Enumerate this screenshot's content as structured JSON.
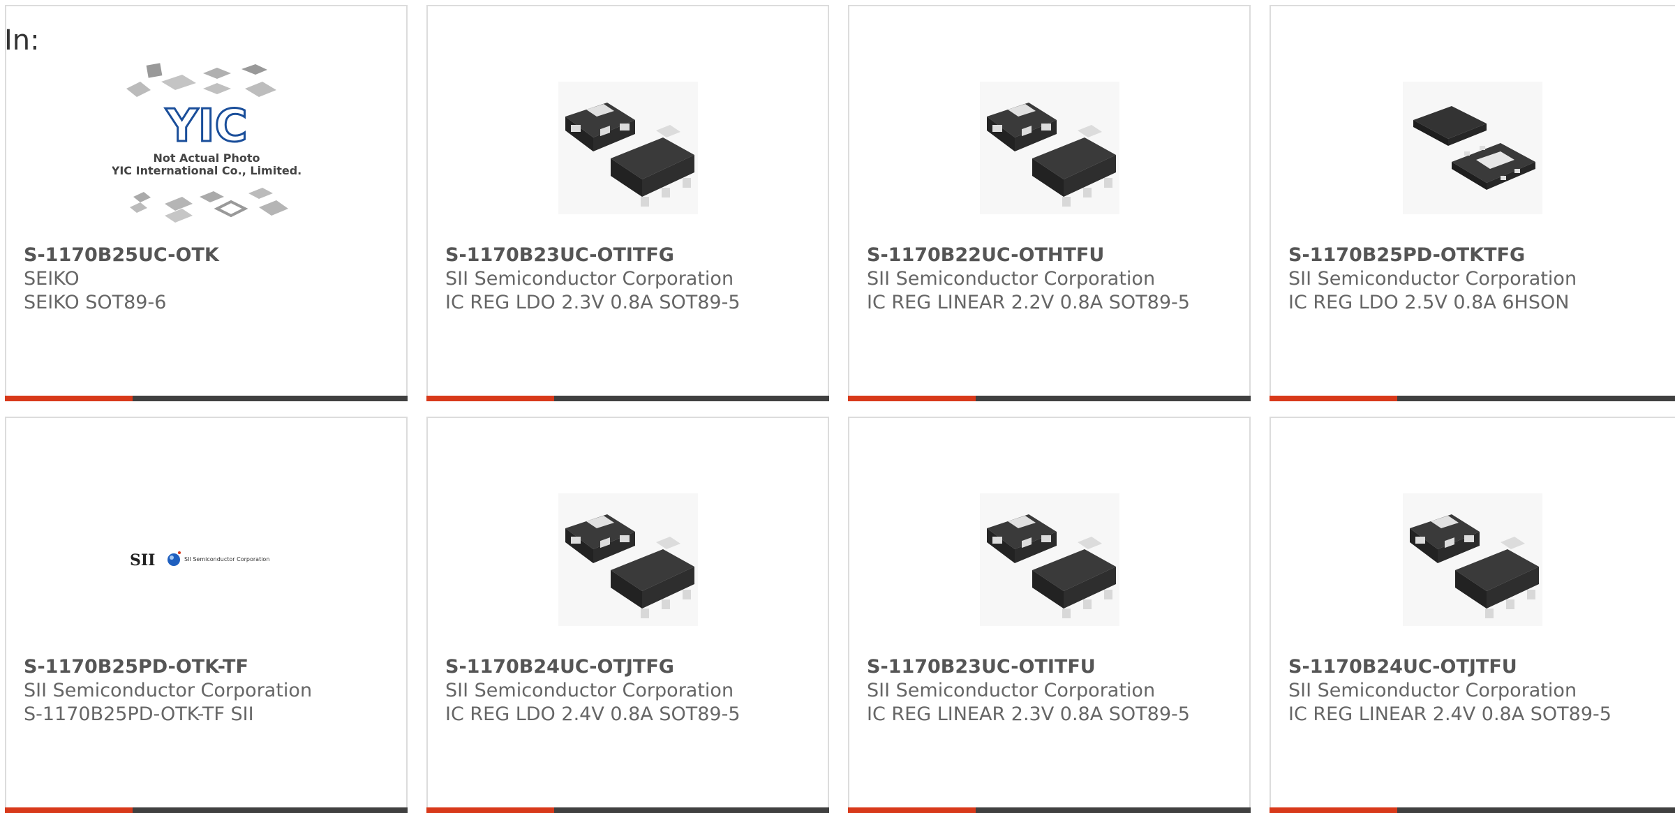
{
  "header": {
    "label": "In:"
  },
  "colors": {
    "accent": "#d8391a",
    "bar": "#404040",
    "border": "#dcdcdc"
  },
  "cards": [
    {
      "part_number": "S-1170B25UC-OTK",
      "manufacturer": "SEIKO",
      "description": "SEIKO SOT89-6",
      "image": "yic-placeholder",
      "image_caption_1": "Not Actual Photo",
      "image_caption_2": "YIC International Co., Limited."
    },
    {
      "part_number": "S-1170B23UC-OTITFG",
      "manufacturer": "SII Semiconductor Corporation",
      "description": "IC REG LDO 2.3V 0.8A SOT89-5",
      "image": "sot89-package"
    },
    {
      "part_number": "S-1170B22UC-OTHTFU",
      "manufacturer": "SII Semiconductor Corporation",
      "description": "IC REG LINEAR 2.2V 0.8A SOT89-5",
      "image": "sot89-package"
    },
    {
      "part_number": "S-1170B25PD-OTKTFG",
      "manufacturer": "SII Semiconductor Corporation",
      "description": "IC REG LDO 2.5V 0.8A 6HSON",
      "image": "hson-package"
    },
    {
      "part_number": "S-1170B25PD-OTK-TF",
      "manufacturer": "SII Semiconductor Corporation",
      "description": "S-1170B25PD-OTK-TF SII",
      "image": "sii-logo",
      "logo_text": "SII",
      "logo_subtext": "SII Semiconductor Corporation"
    },
    {
      "part_number": "S-1170B24UC-OTJTFG",
      "manufacturer": "SII Semiconductor Corporation",
      "description": "IC REG LDO 2.4V 0.8A SOT89-5",
      "image": "sot89-package"
    },
    {
      "part_number": "S-1170B23UC-OTITFU",
      "manufacturer": "SII Semiconductor Corporation",
      "description": "IC REG LINEAR 2.3V 0.8A SOT89-5",
      "image": "sot89-package"
    },
    {
      "part_number": "S-1170B24UC-OTJTFU",
      "manufacturer": "SII Semiconductor Corporation",
      "description": "IC REG LINEAR 2.4V 0.8A SOT89-5",
      "image": "sot89-package"
    }
  ]
}
